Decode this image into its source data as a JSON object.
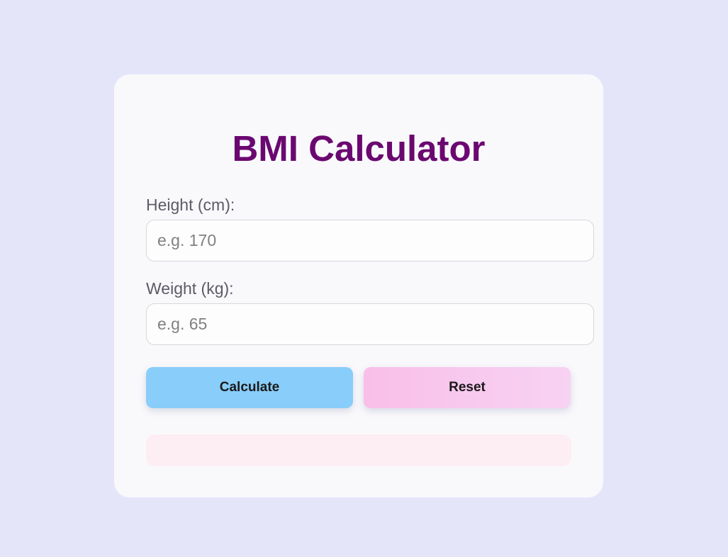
{
  "app": {
    "title": "BMI Calculator"
  },
  "form": {
    "height_label": "Height (cm):",
    "height_placeholder": "e.g. 170",
    "height_value": "",
    "weight_label": "Weight (kg):",
    "weight_placeholder": "e.g. 65",
    "weight_value": ""
  },
  "actions": {
    "calculate_label": "Calculate",
    "reset_label": "Reset"
  },
  "result": {
    "text": ""
  },
  "colors": {
    "background": "#e5e5fa",
    "card": "#f9f9fc",
    "title": "#6b0870",
    "calculate_button": "#89cdfa",
    "reset_button": "#f8c6ec",
    "result_box": "#fdeef3"
  }
}
